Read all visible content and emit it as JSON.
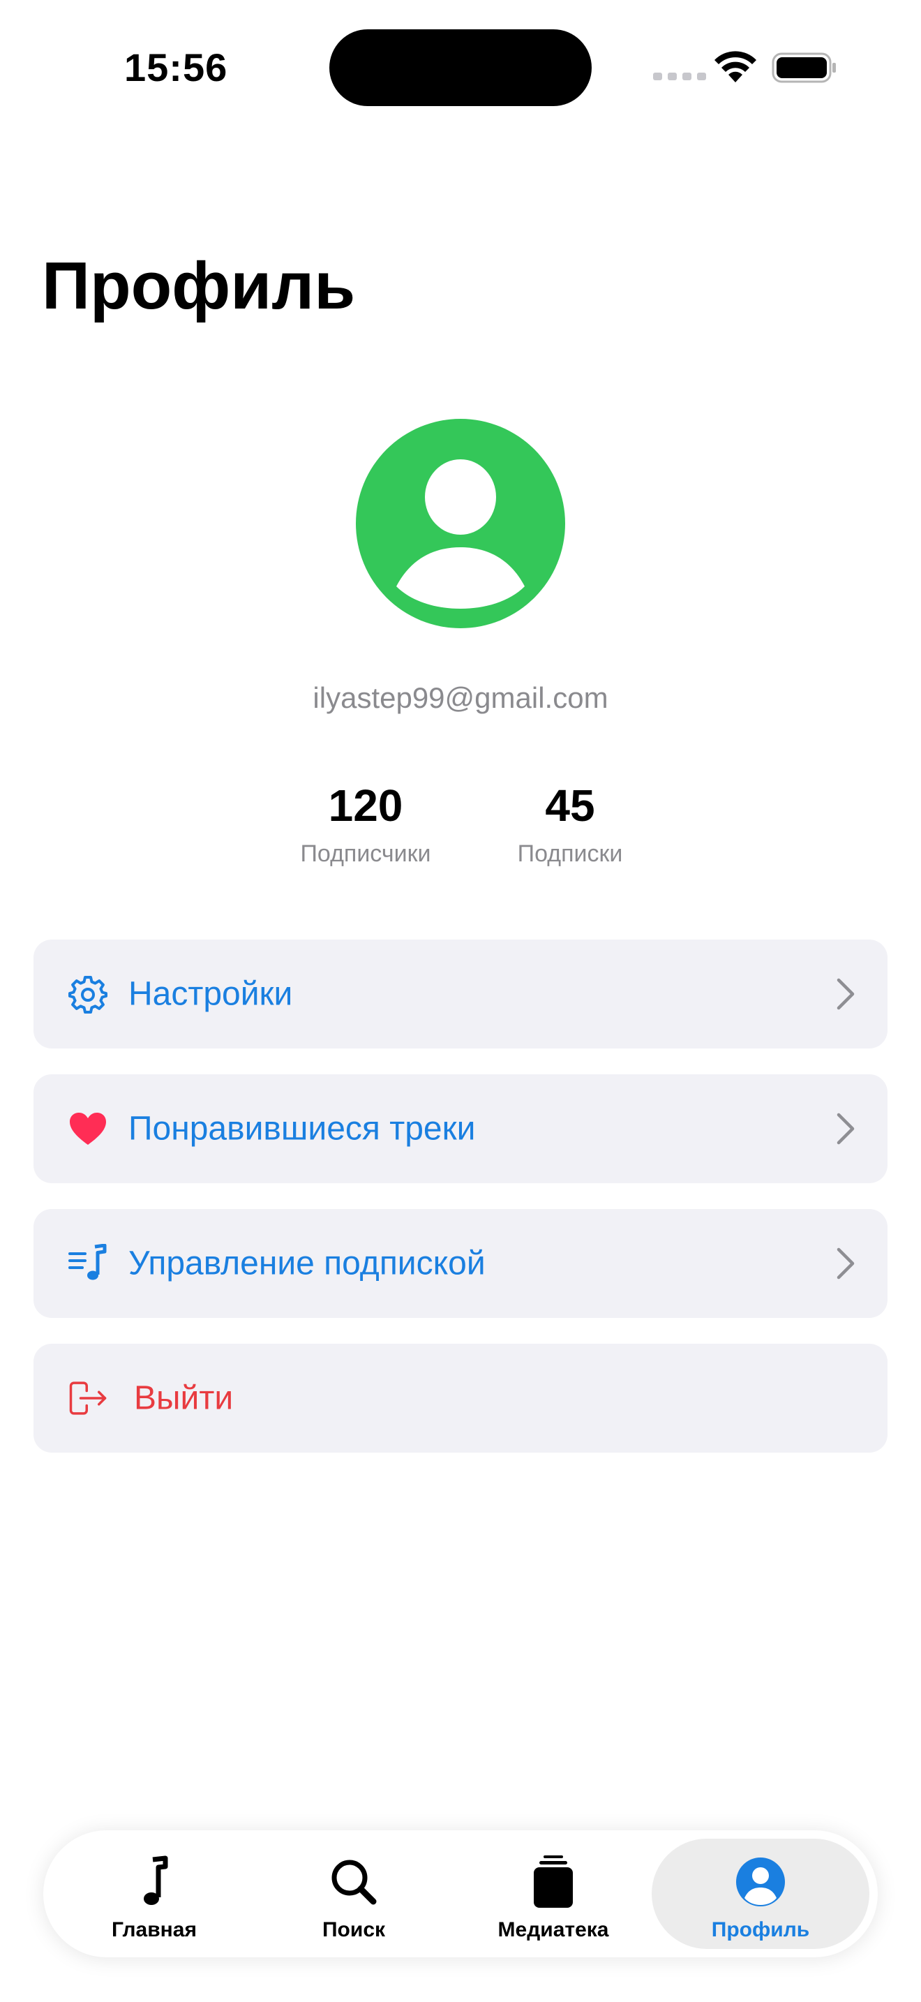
{
  "status_bar": {
    "time": "15:56"
  },
  "page": {
    "title": "Профиль"
  },
  "profile": {
    "email": "ilyastep99@gmail.com",
    "avatar_color": "#34c759",
    "stats": [
      {
        "value": "120",
        "label": "Подписчики"
      },
      {
        "value": "45",
        "label": "Подписки"
      }
    ]
  },
  "menu": {
    "items": [
      {
        "label": "Настройки",
        "icon": "gear-icon"
      },
      {
        "label": "Понравившиеся треки",
        "icon": "heart-icon"
      },
      {
        "label": "Управление подпиской",
        "icon": "music-list-icon"
      }
    ],
    "logout": {
      "label": "Выйти",
      "icon": "logout-icon"
    }
  },
  "tab_bar": {
    "tabs": [
      {
        "label": "Главная",
        "icon": "music-note-icon"
      },
      {
        "label": "Поиск",
        "icon": "search-icon"
      },
      {
        "label": "Медиатека",
        "icon": "library-icon"
      },
      {
        "label": "Профиль",
        "icon": "person-circle-icon"
      }
    ],
    "active_index": 3
  },
  "colors": {
    "accent": "#1a7fe0",
    "destructive": "#e83b40",
    "heart": "#ff2d55",
    "avatar": "#34c759",
    "card_background": "#f1f1f6",
    "secondary_text": "#8a8a8e"
  }
}
